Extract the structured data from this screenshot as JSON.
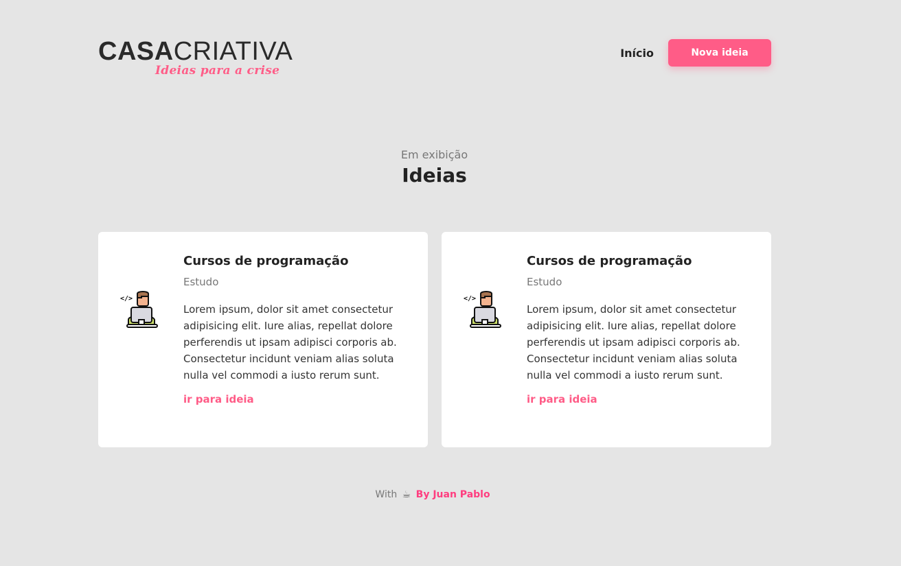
{
  "brand": {
    "name_bold": "CASA",
    "name_light": "CRIATIVA",
    "tagline": "Ideias para a crise",
    "accent_color": "#ff5c87"
  },
  "nav": {
    "home_label": "Início",
    "new_idea_label": "Nova ideia"
  },
  "section": {
    "subtitle": "Em exibição",
    "title": "Ideias"
  },
  "ideas": [
    {
      "icon": "programmer-icon",
      "title": "Cursos de programação",
      "category": "Estudo",
      "description": "Lorem ipsum, dolor sit amet consectetur adipisicing elit. Iure alias, repellat dolore perferendis ut ipsam adipisci corporis ab. Consectetur incidunt veniam alias soluta nulla vel commodi a iusto rerum sunt.",
      "link_label": "ir para ideia"
    },
    {
      "icon": "programmer-icon",
      "title": "Cursos de programação",
      "category": "Estudo",
      "description": "Lorem ipsum, dolor sit amet consectetur adipisicing elit. Iure alias, repellat dolore perferendis ut ipsam adipisci corporis ab. Consectetur incidunt veniam alias soluta nulla vel commodi a iusto rerum sunt.",
      "link_label": "ir para ideia"
    }
  ],
  "footer": {
    "with_label": "With",
    "coffee_icon": "☕",
    "author_label": "By Juan Pablo"
  }
}
